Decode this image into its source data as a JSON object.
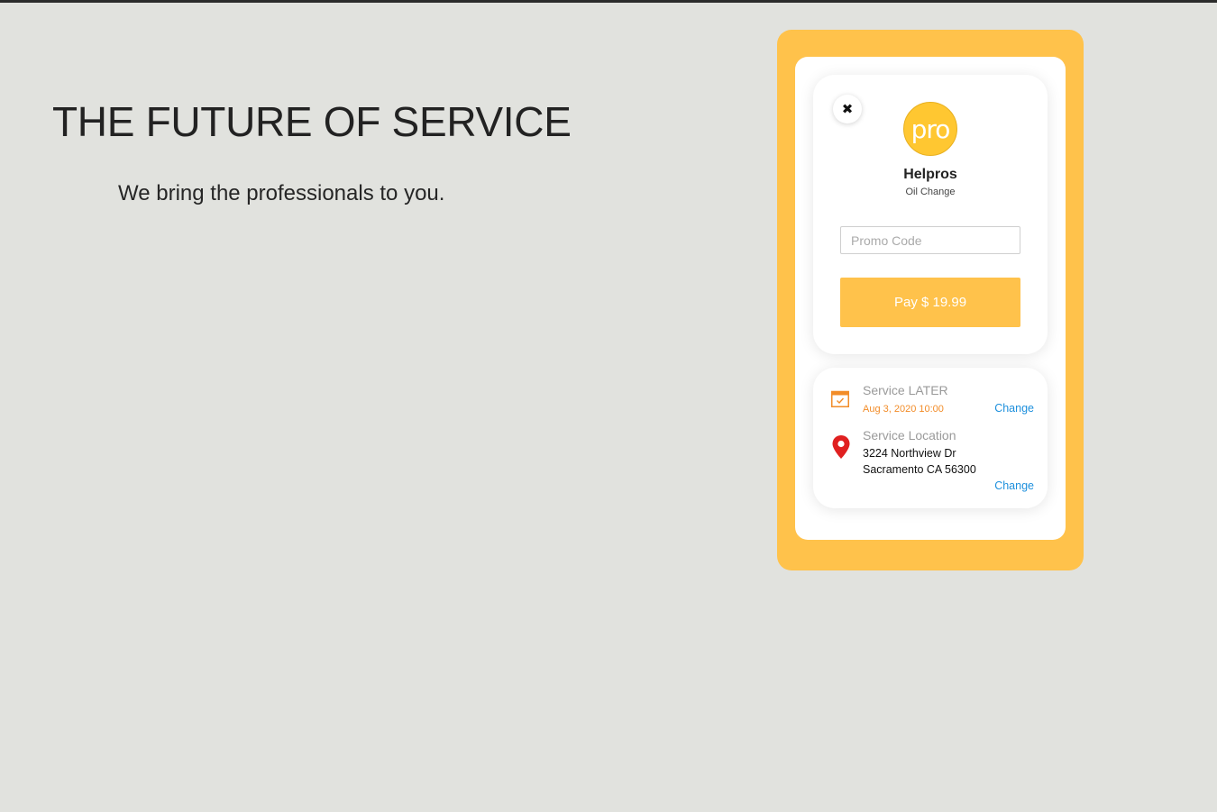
{
  "hero": {
    "title": "THE FUTURE OF SERVICE",
    "subtitle": "We bring the professionals to you."
  },
  "colors": {
    "background": "#e1e2de",
    "accent": "#ffc24b",
    "logo": "#ffc731",
    "date": "#f28c28",
    "link": "#1e90dd",
    "pin": "#e02020"
  },
  "payment": {
    "close_icon": "close-icon",
    "logo_text": "pro",
    "company": "Helpros",
    "service": "Oil Change",
    "promo_placeholder": "Promo Code",
    "promo_value": "",
    "pay_label": "Pay $ 19.99"
  },
  "schedule": {
    "icon": "calendar-icon",
    "label": "Service LATER",
    "datetime": "Aug 3, 2020 10:00",
    "change_label": "Change"
  },
  "location": {
    "icon": "map-pin-icon",
    "label": "Service Location",
    "address_line1": "3224 Northview Dr",
    "address_line2": "Sacramento CA 56300",
    "change_label": "Change"
  }
}
